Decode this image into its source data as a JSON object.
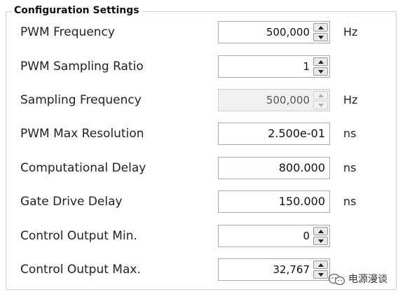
{
  "group": {
    "title": "Configuration Settings"
  },
  "rows": [
    {
      "label": "PWM Frequency",
      "value": "500,000",
      "unit": "Hz"
    },
    {
      "label": "PWM Sampling Ratio",
      "value": "1",
      "unit": ""
    },
    {
      "label": "Sampling Frequency",
      "value": "500,000",
      "unit": "Hz"
    },
    {
      "label": "PWM Max Resolution",
      "value": "2.500e-01",
      "unit": "ns"
    },
    {
      "label": "Computational Delay",
      "value": "800.000",
      "unit": "ns"
    },
    {
      "label": "Gate Drive Delay",
      "value": "150.000",
      "unit": "ns"
    },
    {
      "label": "Control Output Min.",
      "value": "0",
      "unit": ""
    },
    {
      "label": "Control Output Max.",
      "value": "32,767",
      "unit": ""
    }
  ],
  "watermark": {
    "text": "电源漫谈",
    "icon": "wechat-icon"
  },
  "colors": {
    "border": "#a9a9a9",
    "disabled_bg": "#f0f0f0",
    "text": "#222222"
  }
}
